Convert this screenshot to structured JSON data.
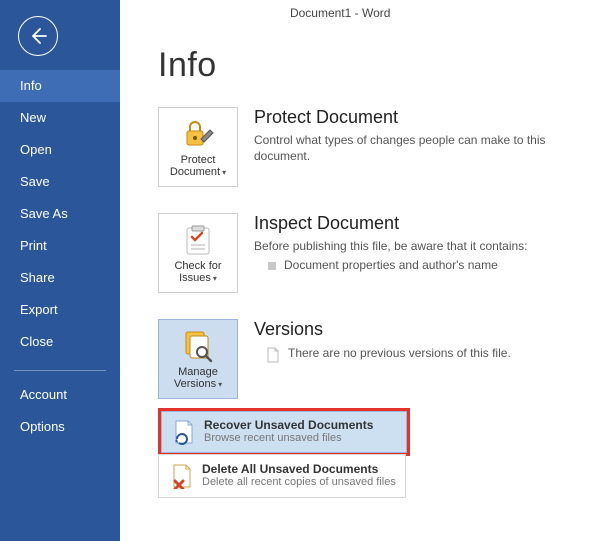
{
  "title": "Document1 - Word",
  "sidebar": {
    "items": [
      {
        "label": "Info",
        "selected": true
      },
      {
        "label": "New"
      },
      {
        "label": "Open"
      },
      {
        "label": "Save"
      },
      {
        "label": "Save As"
      },
      {
        "label": "Print"
      },
      {
        "label": "Share"
      },
      {
        "label": "Export"
      },
      {
        "label": "Close"
      }
    ],
    "footer": [
      {
        "label": "Account"
      },
      {
        "label": "Options"
      }
    ]
  },
  "page": {
    "heading": "Info",
    "sections": {
      "protect": {
        "button_label": "Protect Document",
        "title": "Protect Document",
        "desc": "Control what types of changes people can make to this document."
      },
      "inspect": {
        "button_label": "Check for Issues",
        "title": "Inspect Document",
        "desc": "Before publishing this file, be aware that it contains:",
        "bullet": "Document properties and author's name"
      },
      "versions": {
        "button_label": "Manage Versions",
        "title": "Versions",
        "desc": "There are no previous versions of this file."
      }
    },
    "dropdown": {
      "recover": {
        "title": "Recover Unsaved Documents",
        "desc": "Browse recent unsaved files"
      },
      "delete": {
        "title": "Delete All Unsaved Documents",
        "desc": "Delete all recent copies of unsaved files"
      }
    }
  }
}
